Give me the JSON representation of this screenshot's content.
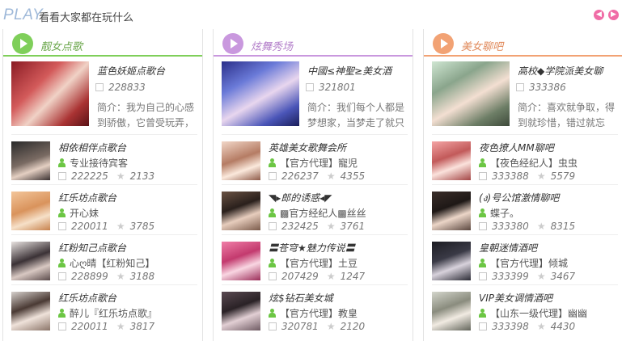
{
  "header": {
    "logo_text": "PLAY",
    "subtitle": "看看大家都在玩什么"
  },
  "colors": {
    "green": "#7fcf5a",
    "purple": "#c998de",
    "orange": "#f2a274"
  },
  "panels": [
    {
      "title": "靓女点歌",
      "featured": {
        "name": "蓝色妖姬点歌台",
        "id": "228833",
        "desc": "简介：我为自己的心感到骄傲，它曾受玩弄，"
      },
      "items": [
        {
          "name": "相依相伴点歌台",
          "host": "专业接待宾客",
          "id": "222225",
          "count": "2133"
        },
        {
          "name": "红乐坊点歌台",
          "host": "开心妹",
          "id": "220011",
          "count": "3785"
        },
        {
          "name": "红粉知己点歌台",
          "host": "心ღ晴【红粉知己】",
          "id": "228899",
          "count": "3188"
        },
        {
          "name": "红乐坊点歌台",
          "host": "醉儿『红乐坊点歌』",
          "id": "220011",
          "count": "3817"
        }
      ]
    },
    {
      "title": "炫舞秀场",
      "featured": {
        "name": "中國≤神聖≥美女酒",
        "id": "321801",
        "desc": "简介：我们每个人都是梦想家，当梦走了就只"
      },
      "items": [
        {
          "name": "英雄美女歌舞会所",
          "host": "【官方代理】寵児",
          "id": "226237",
          "count": "4355"
        },
        {
          "name": "◥▸郎的诱惑◂◤",
          "host": "▩官方经纪人▩丝丝",
          "id": "232425",
          "count": "3761"
        },
        {
          "name": "〓苍穹★魅力传说〓",
          "host": "【官方代理】土豆",
          "id": "207429",
          "count": "1247"
        },
        {
          "name": "炫$钻石美女城",
          "host": "【官方代理】教皇",
          "id": "320781",
          "count": "2120"
        }
      ]
    },
    {
      "title": "美女聊吧",
      "featured": {
        "name": "高校◆学院派美女聊",
        "id": "333386",
        "desc": "简介：喜欢就争取，得到就珍惜，错过就忘"
      },
      "items": [
        {
          "name": "夜色撩人MM聊吧",
          "host": "【夜色经纪人】虫虫",
          "id": "333388",
          "count": "5579"
        },
        {
          "name": "(ง)号公馆激情聊吧",
          "host": "蝶子。",
          "id": "333380",
          "count": "8315"
        },
        {
          "name": "皇朝迷情酒吧",
          "host": "【官方代理】倾城",
          "id": "333399",
          "count": "3467"
        },
        {
          "name": "VIP美女调情酒吧",
          "host": "【山东一级代理】幽幽",
          "id": "333398",
          "count": "4430"
        }
      ]
    }
  ]
}
